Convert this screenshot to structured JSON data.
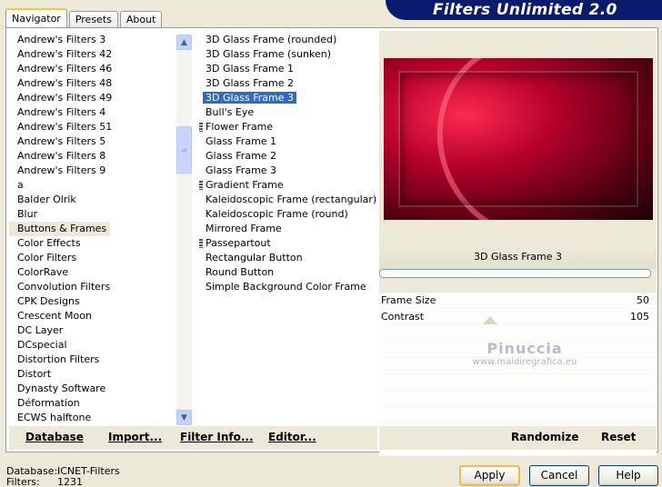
{
  "app": {
    "title": "Filters Unlimited 2.0",
    "tabs": [
      {
        "label": "Navigator",
        "active": true
      },
      {
        "label": "Presets",
        "active": false
      },
      {
        "label": "About",
        "active": false
      }
    ]
  },
  "categories": {
    "selected_index": 13,
    "items": [
      "Andrew's Filters 3",
      "Andrew's Filters 42",
      "Andrew's Filters 46",
      "Andrew's Filters 48",
      "Andrew's Filters 49",
      "Andrew's Filters 4",
      "Andrew's Filters 51",
      "Andrew's Filters 5",
      "Andrew's Filters 8",
      "Andrew's Filters 9",
      "a",
      "Balder Olrik",
      "Blur",
      "Buttons & Frames",
      "Color Effects",
      "Color Filters",
      "ColorRave",
      "Convolution Filters",
      "CPK Designs",
      "Crescent Moon",
      "DC Layer",
      "DCspecial",
      "Distortion Filters",
      "Distort",
      "Dynasty Software",
      "Déformation",
      "ECWS halftone"
    ]
  },
  "filters": {
    "selected_index": 4,
    "items": [
      {
        "label": "3D Glass Frame (rounded)",
        "grip": false
      },
      {
        "label": "3D Glass Frame (sunken)",
        "grip": false
      },
      {
        "label": "3D Glass Frame 1",
        "grip": false
      },
      {
        "label": "3D Glass Frame 2",
        "grip": false
      },
      {
        "label": "3D Glass Frame 3",
        "grip": false
      },
      {
        "label": "Bull's Eye",
        "grip": false
      },
      {
        "label": "Flower Frame",
        "grip": true
      },
      {
        "label": "Glass Frame 1",
        "grip": false
      },
      {
        "label": "Glass Frame 2",
        "grip": false
      },
      {
        "label": "Glass Frame 3",
        "grip": false
      },
      {
        "label": "Gradient Frame",
        "grip": true
      },
      {
        "label": "Kaleidoscopic Frame (rectangular)",
        "grip": false
      },
      {
        "label": "Kaleidoscopic Frame (round)",
        "grip": false
      },
      {
        "label": "Mirrored Frame",
        "grip": false
      },
      {
        "label": "Passepartout",
        "grip": true
      },
      {
        "label": "Rectangular Button",
        "grip": false
      },
      {
        "label": "Round Button",
        "grip": false
      },
      {
        "label": "Simple Background Color Frame",
        "grip": false
      }
    ]
  },
  "preview": {
    "filter_name": "3D Glass Frame 3",
    "params": [
      {
        "label": "Frame Size",
        "value": "50"
      },
      {
        "label": "Contrast",
        "value": "105"
      }
    ],
    "watermark_name": "Pinuccia",
    "watermark_url": "www.maidiregrafica.eu"
  },
  "toolbar": {
    "database": "Database",
    "import": "Import...",
    "filter_info": "Filter Info...",
    "editor": "Editor...",
    "randomize": "Randomize",
    "reset": "Reset"
  },
  "footer": {
    "database_label": "Database:",
    "database_value": "ICNET-Filters",
    "filters_label": "Filters:",
    "filters_value": "1231",
    "apply": "Apply",
    "cancel": "Cancel",
    "help": "Help"
  },
  "colors": {
    "selection": "#316ac5",
    "banner": "#0a1b6e",
    "window_bg": "#ece9d8"
  }
}
